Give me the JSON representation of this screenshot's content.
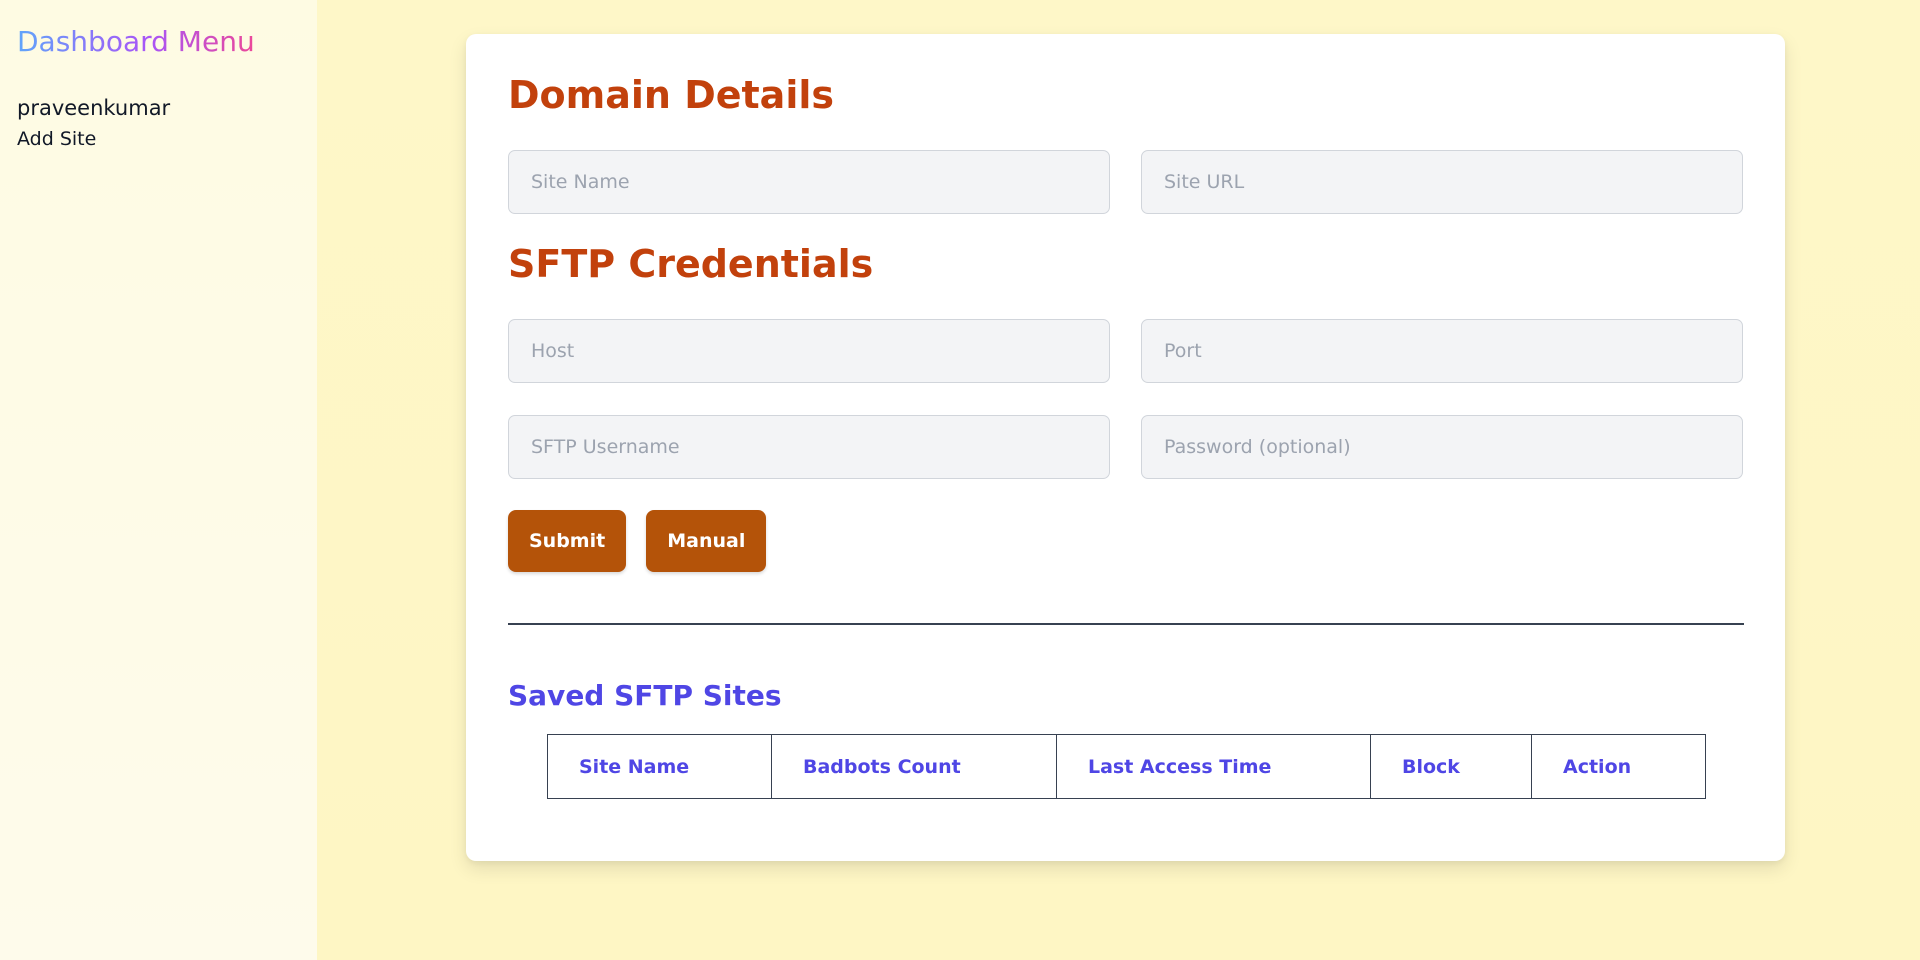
{
  "sidebar": {
    "title": "Dashboard Menu",
    "username": "praveenkumar",
    "links": [
      {
        "label": "Add Site"
      }
    ]
  },
  "domain_details": {
    "heading": "Domain Details",
    "site_name_placeholder": "Site Name",
    "site_url_placeholder": "Site URL"
  },
  "sftp_credentials": {
    "heading": "SFTP Credentials",
    "host_placeholder": "Host",
    "port_placeholder": "Port",
    "username_placeholder": "SFTP Username",
    "password_placeholder": "Password (optional)"
  },
  "buttons": {
    "submit": "Submit",
    "manual": "Manual"
  },
  "saved_sites": {
    "title": "Saved SFTP Sites",
    "columns": [
      "Site Name",
      "Badbots Count",
      "Last Access Time",
      "Block",
      "Action"
    ],
    "rows": []
  },
  "colors": {
    "accent_orange": "#c2410c",
    "button_brown": "#b45309",
    "accent_indigo": "#4f46e5",
    "background_yellow": "#fef7c7"
  }
}
